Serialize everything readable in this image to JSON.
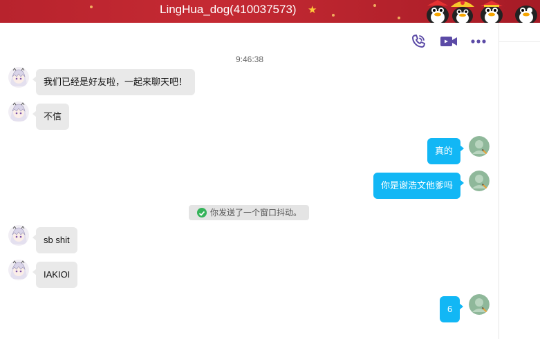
{
  "titlebar": {
    "title": "LingHua_dog(410037573)",
    "star_icon": "star-icon",
    "decoration": "penguin-mascots"
  },
  "toolbar": {
    "voice_call_icon": "phone-icon",
    "video_call_icon": "video-camera-icon",
    "more_icon": "more-dots-icon",
    "accent_color": "#5b4aa6"
  },
  "chat": {
    "timestamp": "9:46:38",
    "messages": [
      {
        "side": "in",
        "text": "我们已经是好友啦，一起来聊天吧！"
      },
      {
        "side": "in",
        "text": "不信"
      },
      {
        "side": "out",
        "text": "真的"
      },
      {
        "side": "out",
        "text": "你是谢浩文他爹吗"
      },
      {
        "side": "notice",
        "text": "你发送了一个窗口抖动。"
      },
      {
        "side": "in",
        "text": "sb shit"
      },
      {
        "side": "in",
        "text": "IAKIOI"
      },
      {
        "side": "out",
        "text": "6"
      }
    ],
    "colors": {
      "incoming_bubble": "#e9e9e9",
      "outgoing_bubble": "#12b7f5",
      "notice_check": "#35b35a"
    }
  }
}
